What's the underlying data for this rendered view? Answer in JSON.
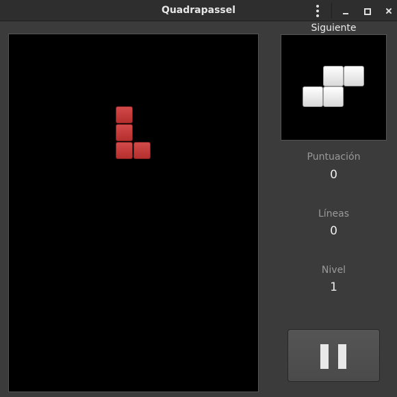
{
  "window": {
    "title": "Quadrapassel"
  },
  "icons": {
    "menu": "vertical-dots-icon",
    "minimize": "minimize-icon",
    "maximize": "maximize-icon",
    "close": "close-icon",
    "pause": "pause-icon"
  },
  "colors": {
    "current_piece": "#c83a3a",
    "next_piece": "#eeeeee",
    "board_background": "#000000"
  },
  "board": {
    "current_piece": "L"
  },
  "preview": {
    "label": "Siguiente",
    "next_piece": "S"
  },
  "stats": {
    "score_label": "Puntuación",
    "score_value": "0",
    "lines_label": "Líneas",
    "lines_value": "0",
    "level_label": "Nivel",
    "level_value": "1"
  }
}
